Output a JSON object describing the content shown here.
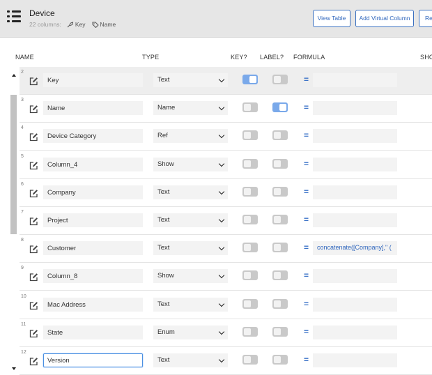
{
  "header": {
    "title": "Device",
    "column_count": "22 columns:",
    "key_tag": "Key",
    "label_tag": "Name",
    "buttons": {
      "view_table": "View Table",
      "add_virtual_column": "Add Virtual Column",
      "regenerate": "Re"
    }
  },
  "columns": {
    "name": "NAME",
    "type": "TYPE",
    "key": "KEY?",
    "label": "LABEL?",
    "formula": "FORMULA",
    "show": "SHO"
  },
  "rows": [
    {
      "num": "2",
      "name": "Key",
      "type": "Text",
      "key": true,
      "label": false,
      "formula": ""
    },
    {
      "num": "3",
      "name": "Name",
      "type": "Name",
      "key": false,
      "label": true,
      "formula": ""
    },
    {
      "num": "4",
      "name": "Device Category",
      "type": "Ref",
      "key": false,
      "label": false,
      "formula": ""
    },
    {
      "num": "5",
      "name": "Column_4",
      "type": "Show",
      "key": false,
      "label": false,
      "formula": ""
    },
    {
      "num": "6",
      "name": "Company",
      "type": "Text",
      "key": false,
      "label": false,
      "formula": ""
    },
    {
      "num": "7",
      "name": "Project",
      "type": "Text",
      "key": false,
      "label": false,
      "formula": ""
    },
    {
      "num": "8",
      "name": "Customer",
      "type": "Text",
      "key": false,
      "label": false,
      "formula": "concatenate([Company],\" ("
    },
    {
      "num": "9",
      "name": "Column_8",
      "type": "Show",
      "key": false,
      "label": false,
      "formula": ""
    },
    {
      "num": "10",
      "name": "Mac Address",
      "type": "Text",
      "key": false,
      "label": false,
      "formula": ""
    },
    {
      "num": "11",
      "name": "State",
      "type": "Enum",
      "key": false,
      "label": false,
      "formula": ""
    },
    {
      "num": "12",
      "name": "Version",
      "type": "Text",
      "key": false,
      "label": false,
      "formula": ""
    }
  ],
  "icons": {
    "menu": "list-menu-icon",
    "row_edit": "pencil-square-icon",
    "key": "key-icon",
    "label": "tag-icon"
  },
  "colors": {
    "accent": "#2f66bd",
    "toggle_on": "#7aa9ea",
    "toggle_off": "#c9c9c9",
    "header_bg": "#e6e6e6"
  }
}
